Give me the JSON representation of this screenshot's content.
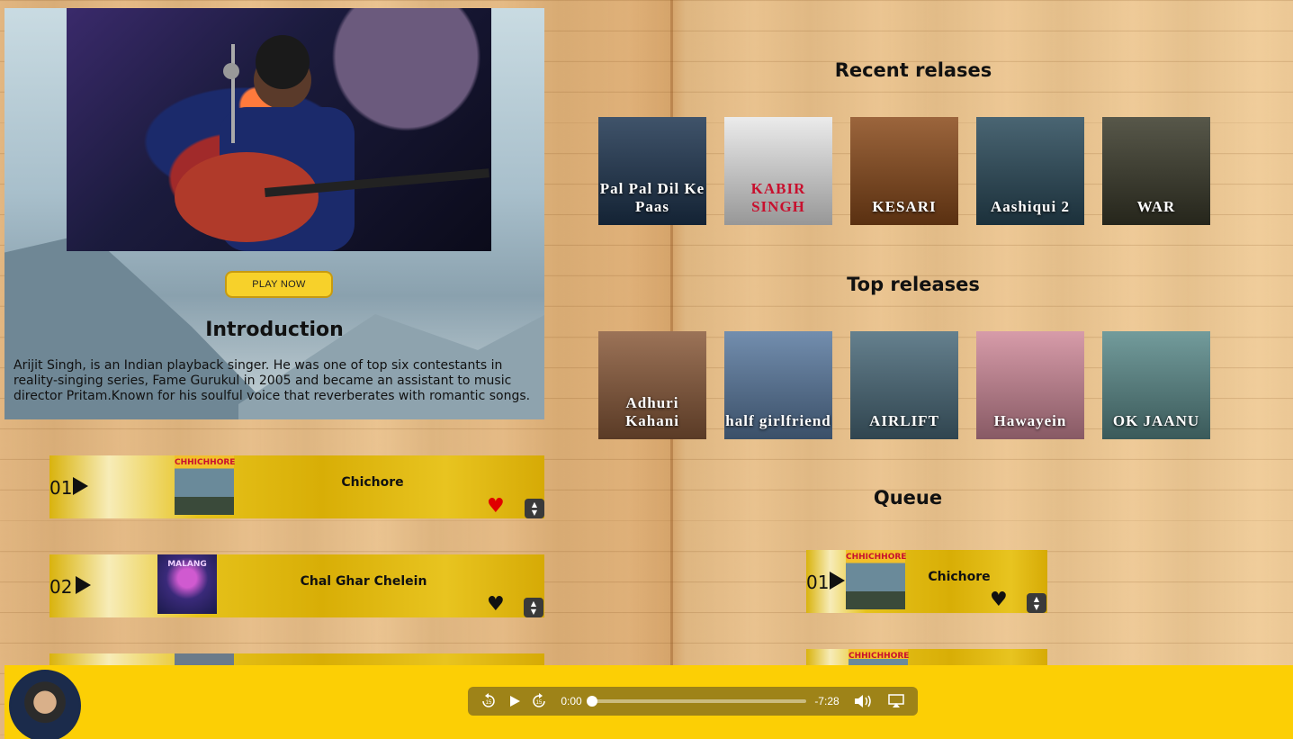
{
  "hero": {
    "photo_alt": "Arijit Singh performing with guitar",
    "play_now_label": "PLAY NOW",
    "intro_title": "Introduction",
    "intro_text": "Arijit Singh, is an Indian playback singer. He was one of top six contestants in reality-singing series, Fame Gurukul in 2005 and became an assistant to music director Pritam.Known for his soulful voice that reverberates with romantic songs."
  },
  "songs": [
    {
      "num": "01",
      "title": "Chichore",
      "cover": "CHHICHHORE",
      "cover_color": "#4a6a7a",
      "heart_color": "#e00000"
    },
    {
      "num": "02",
      "title": "Chal Ghar Chelein",
      "cover": "MALANG",
      "cover_color": "#3a2a7a",
      "heart_color": "#111111"
    },
    {
      "num": "03",
      "title": "",
      "cover": "",
      "cover_color": "#6b6b6b",
      "heart_color": "#111111"
    }
  ],
  "recent": {
    "title": "Recent relases",
    "posters": [
      {
        "label": "Pal Pal Dil Ke Paas",
        "bg": "#1e3550"
      },
      {
        "label": "KABIR SINGH",
        "bg": "#e8e8e8",
        "fg": "#c8102e"
      },
      {
        "label": "KESARI",
        "bg": "#8a4a1a"
      },
      {
        "label": "Aashiqui 2",
        "bg": "#2a4a5a"
      },
      {
        "label": "WAR",
        "bg": "#3a3a2a"
      }
    ]
  },
  "top": {
    "title": "Top releases",
    "posters": [
      {
        "label": "Adhuri Kahani",
        "bg": "#8a5a3a"
      },
      {
        "label": "half girlfriend",
        "bg": "#5a7aa0"
      },
      {
        "label": "AIRLIFT",
        "bg": "#4a6a7a"
      },
      {
        "label": "Hawayein",
        "bg": "#d08a9a"
      },
      {
        "label": "OK JAANU",
        "bg": "#5a8a8a"
      }
    ]
  },
  "queue": {
    "title": "Queue",
    "items": [
      {
        "num": "01",
        "title": "Chichore",
        "cover": "CHHICHHORE"
      },
      {
        "num": "",
        "title": "",
        "cover": "CHHICHHORE"
      }
    ]
  },
  "player": {
    "current_time": "0:00",
    "remaining_time": "-7:28",
    "progress": 0.0,
    "skip_back": "15",
    "skip_forward": "15"
  },
  "colors": {
    "accent": "#fccf05",
    "row_gold": "#e6c21b"
  }
}
